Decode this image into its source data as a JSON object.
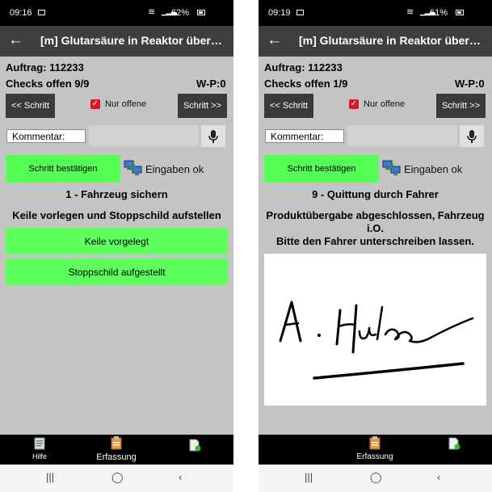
{
  "screens": [
    {
      "status": {
        "time": "09:16",
        "battery": "62%"
      },
      "title": "[m] Glutarsäure in Reaktor überne…",
      "auftrag": "Auftrag: 112233",
      "checks": "Checks offen 9/9",
      "wp": "W-P:0",
      "prev_label": "<< Schritt",
      "next_label": "Schritt >>",
      "nur_offene_label": "Nur offene",
      "nur_offene_checked": true,
      "kommentar_label": "Kommentar:",
      "confirm_label": "Schritt bestätigen",
      "eingaben_label": "Eingaben ok",
      "step_title": "1 - Fahrzeug sichern",
      "step_desc": [
        "Keile vorlegen und Stoppschild aufstellen"
      ],
      "actions": [
        "Keile vorgelegt",
        "Stoppschild aufgestellt"
      ],
      "bottom": {
        "hilfe": "Hilfe",
        "erfassung": "Erfassung"
      }
    },
    {
      "status": {
        "time": "09:19",
        "battery": "61%"
      },
      "title": "[m] Glutarsäure in Reaktor überne…",
      "auftrag": "Auftrag: 112233",
      "checks": "Checks offen 1/9",
      "wp": "W-P:0",
      "prev_label": "<< Schritt",
      "next_label": "Schritt >>",
      "nur_offene_label": "Nur offene",
      "nur_offene_checked": true,
      "kommentar_label": "Kommentar:",
      "confirm_label": "Schritt bestätigen",
      "eingaben_label": "Eingaben ok",
      "step_title": "9 - Quittung durch Fahrer",
      "step_desc": [
        "Produktübergabe abgeschlossen, Fahrzeug",
        "i.O.",
        "Bitte den Fahrer unterschreiben lassen."
      ],
      "signature_present": true,
      "bottom": {
        "erfassung": "Erfassung"
      }
    }
  ]
}
